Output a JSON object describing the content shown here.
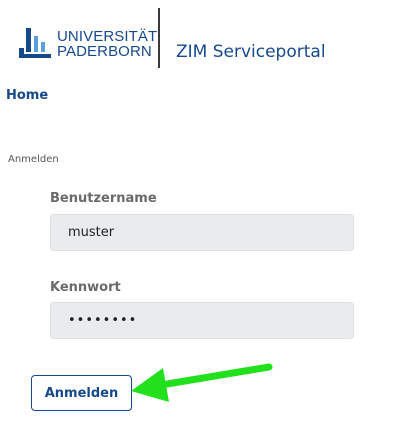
{
  "header": {
    "logo_line1": "UNIVERSITÄT",
    "logo_line2": "PADERBORN",
    "portal_title": "ZIM Serviceportal"
  },
  "nav": {
    "home": "Home"
  },
  "login": {
    "section_label": "Anmelden",
    "username_label": "Benutzername",
    "username_value": "muster",
    "password_label": "Kennwort",
    "password_value": "••••••••",
    "submit_label": "Anmelden"
  },
  "colors": {
    "brand_blue": "#16498b",
    "field_bg": "#e9ebed",
    "annotation_arrow": "#22e01c"
  },
  "annotation": {
    "icon": "green-arrow-icon",
    "points_to": "Anmelden button"
  }
}
